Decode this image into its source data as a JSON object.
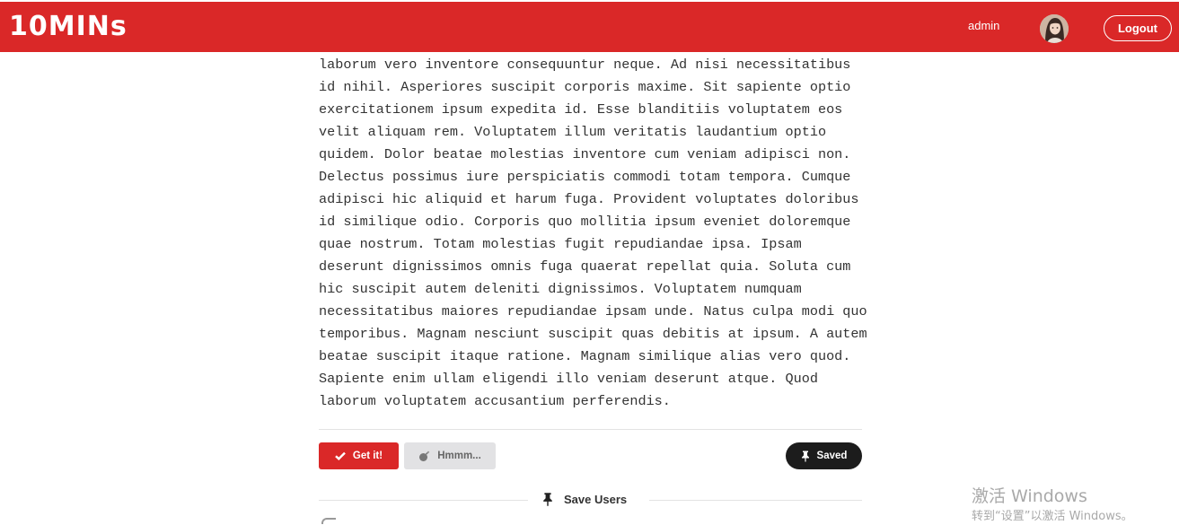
{
  "header": {
    "logo": "10MINs",
    "username": "admin",
    "logout_label": "Logout",
    "brand_color": "#da2828"
  },
  "article": {
    "lines": [
      "laborum vero inventore consequuntur neque. Ad nisi necessitatibus",
      "id nihil. Asperiores suscipit corporis maxime. Sit sapiente optio",
      "exercitationem ipsum expedita id. Esse blanditiis voluptatem eos",
      "velit aliquam rem. Voluptatem illum veritatis laudantium optio",
      "quidem. Dolor beatae molestias inventore cum veniam adipisci non.",
      "Delectus possimus iure perspiciatis commodi totam tempora. Cumque",
      "adipisci hic aliquid et harum fuga. Provident voluptates doloribus",
      "id similique odio. Corporis quo mollitia ipsum eveniet doloremque",
      "quae nostrum. Totam molestias fugit repudiandae ipsa. Ipsam",
      "deserunt dignissimos omnis fuga quaerat repellat quia. Soluta cum",
      "hic suscipit autem deleniti dignissimos. Voluptatem numquam",
      "necessitatibus maiores repudiandae ipsam unde. Natus culpa modi quo",
      "temporibus. Magnam nesciunt suscipit quas debitis at ipsum. A autem",
      "beatae suscipit itaque ratione. Magnam similique alias vero quod.",
      "Sapiente enim ullam eligendi illo veniam deserunt atque. Quod",
      "laborum voluptatem accusantium perferendis."
    ]
  },
  "actions": {
    "get_it_label": "Get it!",
    "hmm_label": "Hmmm...",
    "saved_label": "Saved",
    "get_it_icon": "check-icon",
    "hmm_icon": "bomb-icon",
    "saved_icon": "pin-icon"
  },
  "save_users": {
    "title": "Save Users",
    "icon": "pin-icon"
  },
  "watermark": {
    "title": "激活 Windows",
    "subtitle": "转到“设置”以激活 Windows。"
  }
}
